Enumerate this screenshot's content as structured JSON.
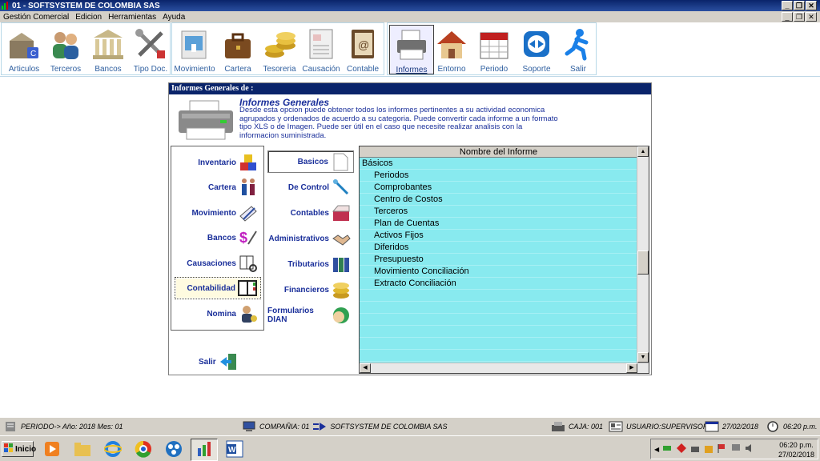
{
  "window": {
    "title": "01 - SOFTSYSTEM DE COLOMBIA SAS"
  },
  "menu": [
    "Gestión Comercial",
    "Edicion",
    "Herramientas",
    "Ayuda"
  ],
  "toolbar": {
    "group1": [
      {
        "label": "Articulos",
        "icon": "articles-icon"
      },
      {
        "label": "Terceros",
        "icon": "people-icon"
      },
      {
        "label": "Bancos",
        "icon": "bank-icon"
      },
      {
        "label": "Tipo Doc.",
        "icon": "tools-icon"
      }
    ],
    "group2": [
      {
        "label": "Movimiento",
        "icon": "movement-icon"
      },
      {
        "label": "Cartera",
        "icon": "briefcase-icon"
      },
      {
        "label": "Tesoreria",
        "icon": "coins-icon"
      },
      {
        "label": "Causación",
        "icon": "clipboard-icon"
      },
      {
        "label": "Contable",
        "icon": "address-book-icon"
      }
    ],
    "group3": [
      {
        "label": "Informes",
        "icon": "printer-icon"
      },
      {
        "label": "Entorno",
        "icon": "house-icon"
      },
      {
        "label": "Periodo",
        "icon": "calendar-icon"
      },
      {
        "label": "Soporte",
        "icon": "teamviewer-icon"
      },
      {
        "label": "Salir",
        "icon": "runner-icon"
      }
    ]
  },
  "panel": {
    "title": "Informes Generales de :",
    "info_title": "Informes Generales",
    "info_text": "Desde esta opcion puede obtener todos los informes pertinentes a su actividad economica agrupados y ordenados de acuerdo a su categoria. Puede convertir cada informe a un formato tipo XLS o de Imagen. Puede ser útil en el caso que necesite realizar analisis con la informacion suministrada.",
    "categories": [
      "Inventario",
      "Cartera",
      "Movimiento",
      "Bancos",
      "Causaciones",
      "Contabilidad",
      "Nomina"
    ],
    "subcategories": [
      "Basicos",
      "De Control",
      "Contables",
      "Administrativos",
      "Tributarios",
      "Financieros",
      "Formularios DIAN"
    ],
    "exit_label": "Salir",
    "grid_header": "Nombre del Informe",
    "report_group": "Básicos",
    "reports": [
      "Periodos",
      "Comprobantes",
      "Centro de Costos",
      "Terceros",
      "Plan de Cuentas",
      "Activos Fijos",
      "Diferidos",
      "Presupuesto",
      "Movimiento Conciliación",
      "Extracto Conciliación"
    ]
  },
  "status": {
    "period": "PERIODO-> Año: 2018  Mes: 01",
    "company": "COMPAÑIA: 01",
    "company_name": "SOFTSYSTEM DE COLOMBIA SAS",
    "caja": "CAJA: 001",
    "user": "USUARIO:SUPERVISOR",
    "date": "27/02/2018",
    "time": "06:20 p.m."
  },
  "taskbar": {
    "start_label": "Inicio",
    "clock_time": "06:20 p.m.",
    "clock_date": "27/02/2018"
  }
}
